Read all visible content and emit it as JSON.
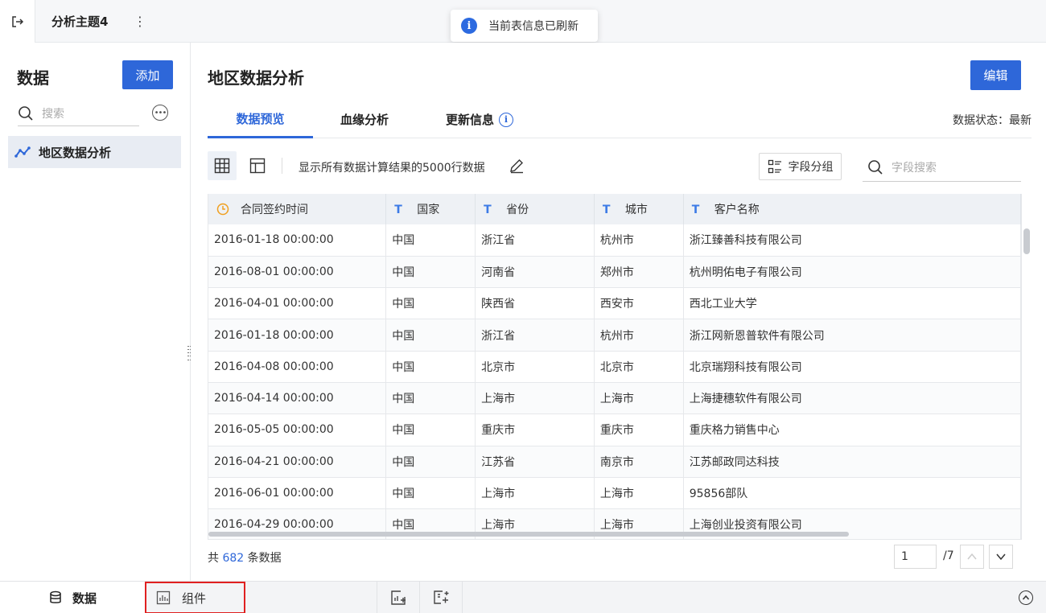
{
  "header": {
    "topic_title": "分析主题4",
    "more_label": "⋮",
    "toast_message": "当前表信息已刷新"
  },
  "left": {
    "title": "数据",
    "add_label": "添加",
    "search_placeholder": "搜索",
    "items": [
      {
        "label": "地区数据分析",
        "icon": "line-chart-icon"
      }
    ]
  },
  "main": {
    "title": "地区数据分析",
    "edit_label": "编辑",
    "tabs": [
      {
        "label": "数据预览",
        "active": true
      },
      {
        "label": "血缘分析",
        "active": false
      },
      {
        "label": "更新信息",
        "active": false,
        "info_icon": "i"
      }
    ],
    "status_label": "数据状态：最新",
    "toolbar": {
      "description": "显示所有数据计算结果的5000行数据",
      "group_label": "字段分组",
      "search_placeholder": "字段搜索"
    },
    "table": {
      "columns": [
        {
          "label": "合同签约时间",
          "type": "date"
        },
        {
          "label": "国家",
          "type": "text"
        },
        {
          "label": "省份",
          "type": "text"
        },
        {
          "label": "城市",
          "type": "text"
        },
        {
          "label": "客户名称",
          "type": "text"
        }
      ],
      "rows": [
        [
          "2016-01-18 00:00:00",
          "中国",
          "浙江省",
          "杭州市",
          "浙江臻善科技有限公司"
        ],
        [
          "2016-08-01 00:00:00",
          "中国",
          "河南省",
          "郑州市",
          "杭州明佑电子有限公司"
        ],
        [
          "2016-04-01 00:00:00",
          "中国",
          "陕西省",
          "西安市",
          "西北工业大学"
        ],
        [
          "2016-01-18 00:00:00",
          "中国",
          "浙江省",
          "杭州市",
          "浙江网新恩普软件有限公司"
        ],
        [
          "2016-04-08 00:00:00",
          "中国",
          "北京市",
          "北京市",
          "北京瑞翔科技有限公司"
        ],
        [
          "2016-04-14 00:00:00",
          "中国",
          "上海市",
          "上海市",
          "上海捷穗软件有限公司"
        ],
        [
          "2016-05-05 00:00:00",
          "中国",
          "重庆市",
          "重庆市",
          "重庆格力销售中心"
        ],
        [
          "2016-04-21 00:00:00",
          "中国",
          "江苏省",
          "南京市",
          "江苏邮政同达科技"
        ],
        [
          "2016-06-01 00:00:00",
          "中国",
          "上海市",
          "上海市",
          "95856部队"
        ],
        [
          "2016-04-29 00:00:00",
          "中国",
          "上海市",
          "上海市",
          "上海创业投资有限公司"
        ]
      ]
    },
    "footer": {
      "count_prefix": "共",
      "count_value": "682",
      "count_suffix": "条数据",
      "page_current": "1",
      "page_total": "/7"
    }
  },
  "bottom": {
    "data_tab": "数据",
    "component_tab": "组件"
  },
  "colors": {
    "accent": "#2e67d9",
    "highlight_border": "#e02020",
    "date_icon": "#f0a020"
  }
}
